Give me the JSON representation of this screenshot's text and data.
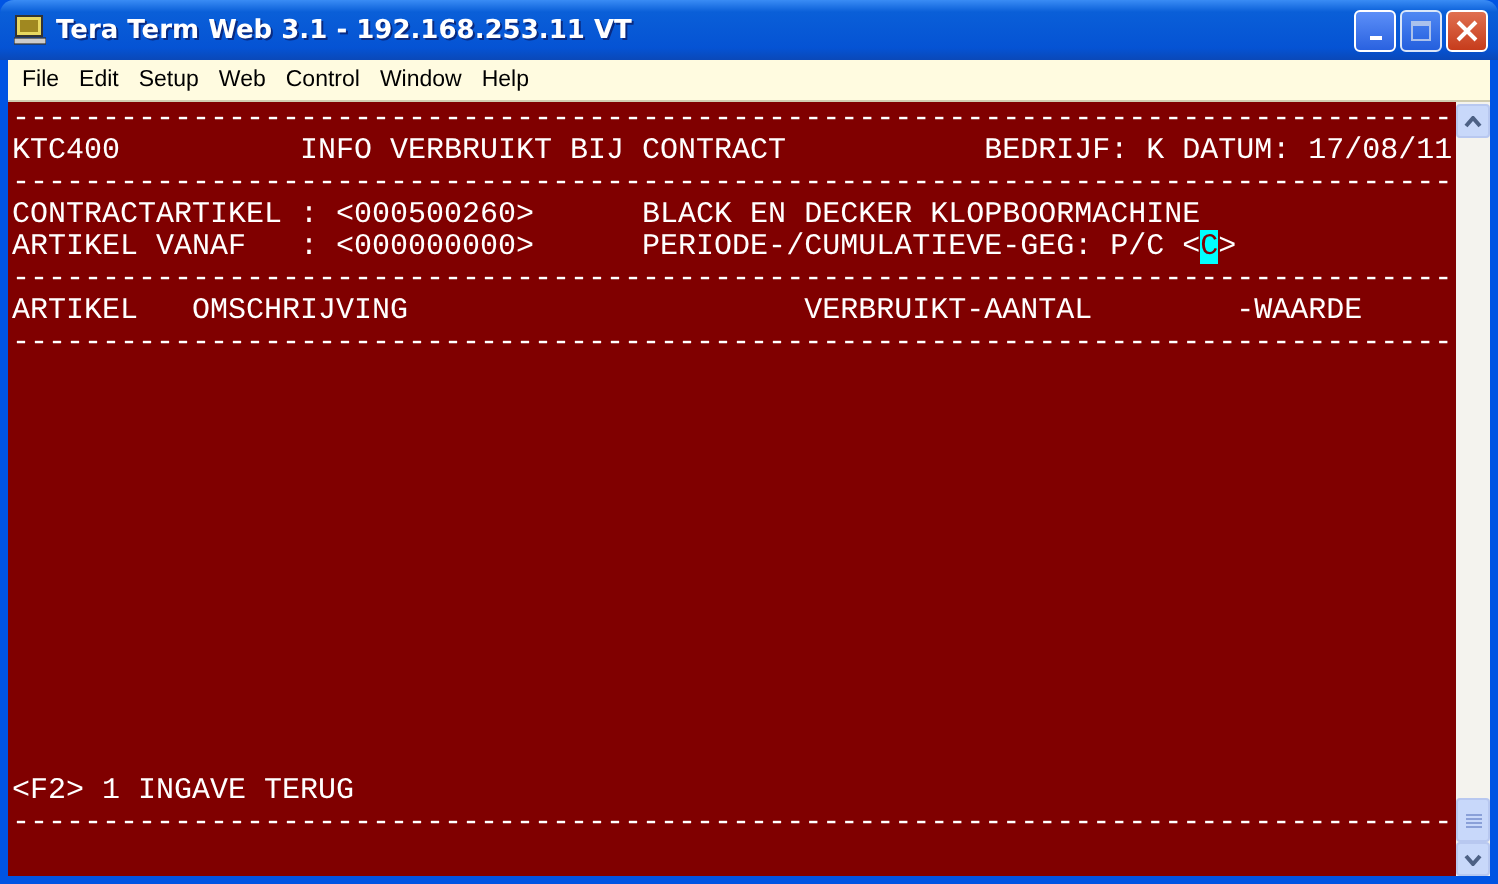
{
  "window": {
    "title": "Tera Term Web 3.1 - 192.168.253.11 VT"
  },
  "menu": [
    {
      "label": "File"
    },
    {
      "label": "Edit"
    },
    {
      "label": "Setup"
    },
    {
      "label": "Web"
    },
    {
      "label": "Control"
    },
    {
      "label": "Window"
    },
    {
      "label": "Help"
    }
  ],
  "terminal": {
    "lines": [
      {
        "kind": "rule",
        "text": "--------------------------------------------------------------------------------"
      },
      {
        "kind": "text",
        "segments": [
          {
            "text": "KTC400          INFO VERBRUIKT BIJ CONTRACT           BEDRIJF: K DATUM: 17/08/11",
            "cursor": false
          }
        ]
      },
      {
        "kind": "rule",
        "text": "--------------------------------------------------------------------------------"
      },
      {
        "kind": "text",
        "segments": [
          {
            "text": "CONTRACTARTIKEL : <000500260>      BLACK EN DECKER KLOPBOORMACHINE",
            "cursor": false
          }
        ]
      },
      {
        "kind": "text",
        "segments": [
          {
            "text": "ARTIKEL VANAF   : <000000000>      PERIODE-/CUMULATIEVE-GEG: P/C <",
            "cursor": false
          },
          {
            "text": "C",
            "cursor": true
          },
          {
            "text": ">",
            "cursor": false
          }
        ]
      },
      {
        "kind": "rule",
        "text": "--------------------------------------------------------------------------------"
      },
      {
        "kind": "text",
        "segments": [
          {
            "text": "ARTIKEL   OMSCHRIJVING                      VERBRUIKT-AANTAL        -WAARDE",
            "cursor": false
          }
        ]
      },
      {
        "kind": "rule",
        "text": "--------------------------------------------------------------------------------"
      },
      {
        "kind": "blank"
      },
      {
        "kind": "blank"
      },
      {
        "kind": "blank"
      },
      {
        "kind": "blank"
      },
      {
        "kind": "blank"
      },
      {
        "kind": "blank"
      },
      {
        "kind": "blank"
      },
      {
        "kind": "blank"
      },
      {
        "kind": "blank"
      },
      {
        "kind": "blank"
      },
      {
        "kind": "blank"
      },
      {
        "kind": "blank"
      },
      {
        "kind": "blank"
      },
      {
        "kind": "text",
        "segments": [
          {
            "text": "<F2> 1 INGAVE TERUG",
            "cursor": false
          }
        ]
      },
      {
        "kind": "rule",
        "text": "--------------------------------------------------------------------------------"
      }
    ]
  }
}
